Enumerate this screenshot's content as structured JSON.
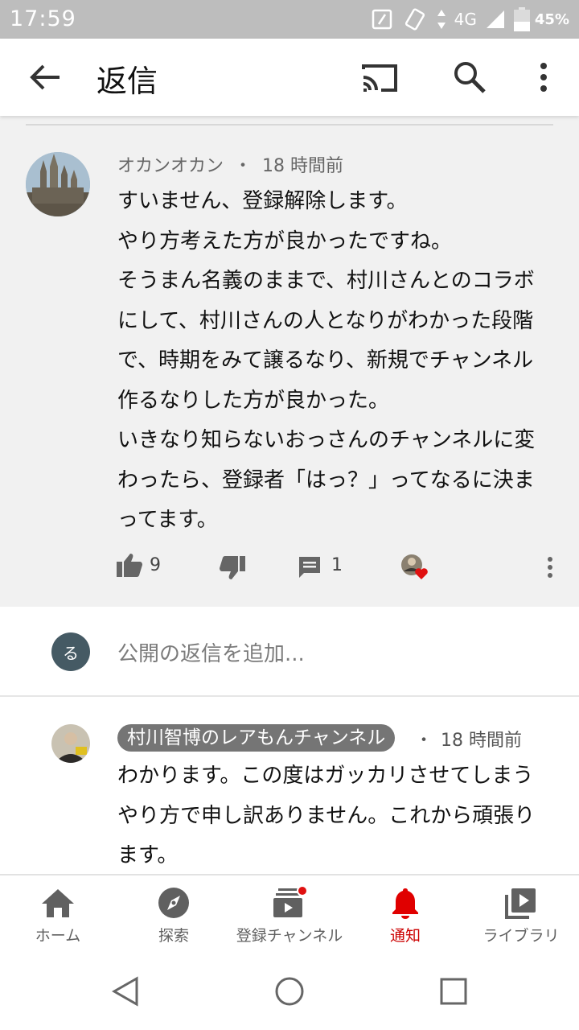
{
  "status_bar": {
    "time": "17:59",
    "network": "4G",
    "battery": "45%",
    "battery_level": 0.45
  },
  "app_bar": {
    "title": "返信"
  },
  "comment": {
    "author": "オカンオカン",
    "separator": "・",
    "time": "18 時間前",
    "lines": [
      "すいません、登録解除します。",
      "やり方考えた方が良かったですね。",
      "そうまん名義のままで、村川さんとのコラボにして、村川さんの人となりがわかった段階で、時期をみて譲るなり、新規でチャンネル作るなりした方が良かった。",
      "いきなり知らないおっさんのチャンネルに変わったら、登録者「はっ？」ってなるに決まってます。"
    ],
    "like_count": "9",
    "reply_count": "1"
  },
  "add_reply": {
    "avatar_letter": "る",
    "placeholder": "公開の返信を追加..."
  },
  "reply": {
    "author": "村川智博のレアもんチャンネル",
    "separator": "・",
    "time": "18 時間前",
    "text": "わかります。この度はガッカリさせてしまうやり方で申し訳ありません。これから頑張ります。"
  },
  "bottom_nav": [
    {
      "label": "ホーム",
      "icon": "home-icon"
    },
    {
      "label": "探索",
      "icon": "compass-icon"
    },
    {
      "label": "登録チャンネル",
      "icon": "subscriptions-icon"
    },
    {
      "label": "通知",
      "icon": "bell-icon",
      "active": true
    },
    {
      "label": "ライブラリ",
      "icon": "library-icon"
    }
  ],
  "colors": {
    "accent": "#cc0000",
    "status_bar": "#bdbdbd",
    "comment_bg": "#f1f1f1",
    "chip": "#757575"
  }
}
